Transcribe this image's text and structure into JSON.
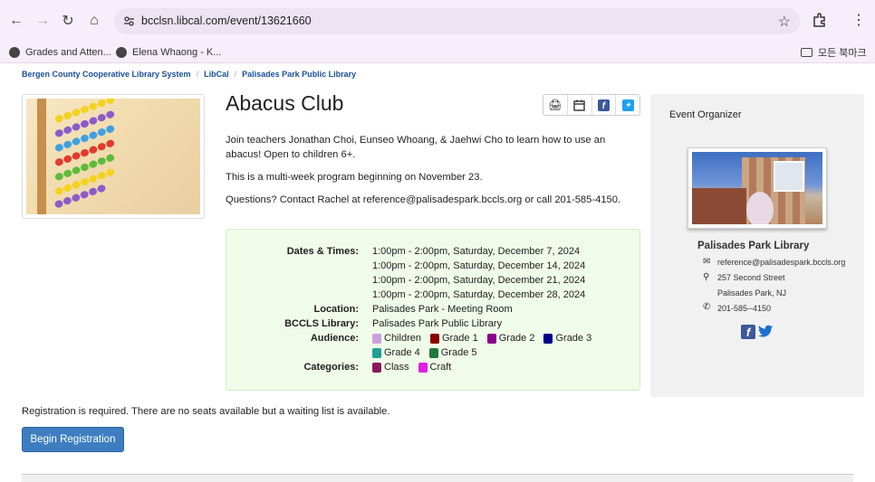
{
  "browser": {
    "url": "bcclsn.libcal.com/event/13621660",
    "bookmarks": [
      "Grades and Atten...",
      "Elena Whaong - K..."
    ],
    "bookmark_folder": "모든 북마크"
  },
  "breadcrumb": [
    "Bergen County Cooperative Library System",
    "LibCal",
    "Palisades Park Public Library"
  ],
  "event": {
    "title": "Abacus Club",
    "description": [
      "Join teachers Jonathan Choi, Eunseo Whoang, & Jaehwi Cho to learn how to use an abacus! Open to children 6+.",
      "This is a multi-week program beginning on November 23.",
      "Questions? Contact Rachel at reference@palisadespark.bccls.org or call 201-585-4150."
    ]
  },
  "details": {
    "dates_label": "Dates & Times:",
    "dates": [
      "1:00pm - 2:00pm, Saturday, December 7, 2024",
      "1:00pm - 2:00pm, Saturday, December 14, 2024",
      "1:00pm - 2:00pm, Saturday, December 21, 2024",
      "1:00pm - 2:00pm, Saturday, December 28, 2024"
    ],
    "location_label": "Location:",
    "location": "Palisades Park - Meeting Room",
    "library_label": "BCCLS Library:",
    "library": "Palisades Park Public Library",
    "audience_label": "Audience:",
    "audience": [
      {
        "label": "Children",
        "color": "#c9a0dc"
      },
      {
        "label": "Grade 1",
        "color": "#8b0000"
      },
      {
        "label": "Grade 2",
        "color": "#8b008b"
      },
      {
        "label": "Grade 3",
        "color": "#00008b"
      },
      {
        "label": "Grade 4",
        "color": "#20a090"
      },
      {
        "label": "Grade 5",
        "color": "#1e7a3a"
      }
    ],
    "categories_label": "Categories:",
    "categories": [
      {
        "label": "Class",
        "color": "#8b1a5a"
      },
      {
        "label": "Craft",
        "color": "#e020e0"
      }
    ]
  },
  "registration": {
    "notice": "Registration is required. There are no seats available but a waiting list is available.",
    "button_label": "Begin Registration"
  },
  "organizer": {
    "heading": "Event Organizer",
    "name": "Palisades Park Library",
    "email": "reference@palisadespark.bccls.org",
    "address1": "257 Second Street",
    "address2": "Palisades Park, NJ",
    "phone": "201-585--4150"
  }
}
